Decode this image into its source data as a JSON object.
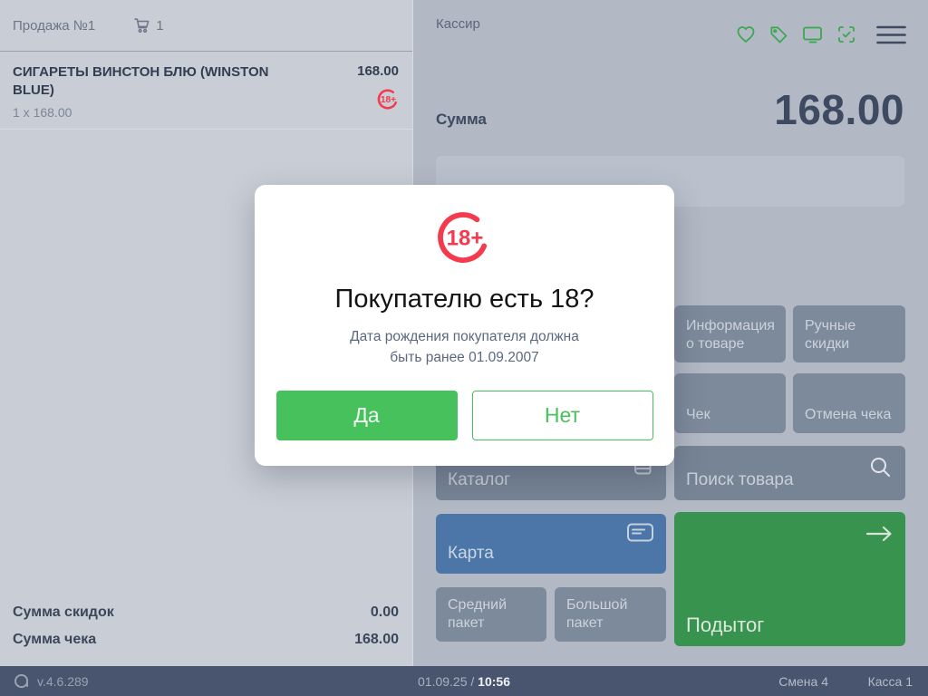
{
  "left_panel": {
    "title": "Продажа №1",
    "cart_count": "1",
    "item": {
      "name": "СИГАРЕТЫ ВИНСТОН БЛЮ (WINSTON BLUE)",
      "price": "168.00",
      "qty_line": "1 x 168.00",
      "age_badge": "18+"
    },
    "summary": {
      "discount_label": "Сумма скидок",
      "discount_value": "0.00",
      "total_label": "Сумма чека",
      "total_value": "168.00"
    }
  },
  "right_panel": {
    "cashier_label": "Кассир",
    "sum_label": "Сумма",
    "sum_value": "168.00",
    "buttons": {
      "product_info": "Информация о товаре",
      "manual_discounts": "Ручные скидки",
      "receipt": "Чек",
      "cancel_receipt": "Отмена чека",
      "catalog": "Каталог",
      "search_product": "Поиск товара",
      "card": "Карта",
      "subtotal": "Подытог",
      "medium_bag": "Средний пакет",
      "big_bag": "Большой пакет"
    }
  },
  "modal": {
    "age_badge": "18+",
    "title": "Покупателю есть 18?",
    "subtitle_line1": "Дата рождения покупателя должна",
    "subtitle_line2": "быть ранее 01.09.2007",
    "yes_label": "Да",
    "no_label": "Нет"
  },
  "footer": {
    "version": "v.4.6.289",
    "date": "01.09.25",
    "separator": " / ",
    "time": "10:56",
    "shift": "Смена 4",
    "register": "Касса 1"
  },
  "colors": {
    "accent_green": "#47c15c",
    "dark_green": "#37934e",
    "icon_green": "#3aa84f",
    "alert_red": "#f43b4d",
    "blue_button": "#4b76a7",
    "left_bg": "#c9cdd5",
    "right_bg": "#b2b8c4",
    "footer_bg": "#49556e"
  }
}
